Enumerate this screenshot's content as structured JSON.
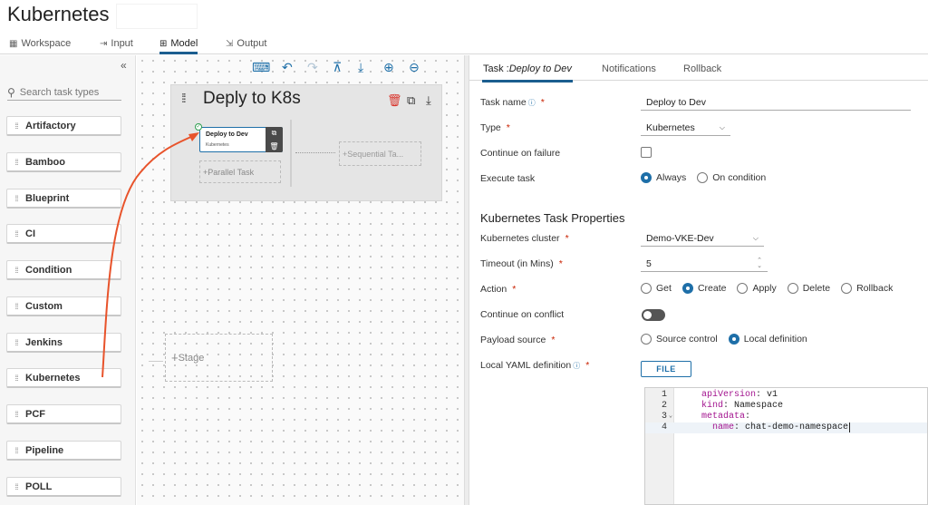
{
  "app": {
    "title": "Kubernetes"
  },
  "main_tabs": [
    {
      "label": "Workspace",
      "icon": "workspace-icon"
    },
    {
      "label": "Input",
      "icon": "input-icon"
    },
    {
      "label": "Model",
      "icon": "model-icon",
      "active": true
    },
    {
      "label": "Output",
      "icon": "output-icon"
    }
  ],
  "palette": {
    "search_placeholder": "Search task types",
    "items": [
      "Artifactory",
      "Bamboo",
      "Blueprint",
      "CI",
      "Condition",
      "Custom",
      "Jenkins",
      "Kubernetes",
      "PCF",
      "Pipeline",
      "POLL"
    ]
  },
  "canvas": {
    "stage": {
      "title": "Deply to K8s",
      "task": {
        "name": "Deploy to Dev",
        "type": "Kubernetes"
      },
      "parallel_task_label": "Parallel Task",
      "sequential_task_label": "Sequential Ta..."
    },
    "empty_stage_label": "Stage"
  },
  "panel": {
    "tabs": {
      "task_prefix": "Task :",
      "task_name": "Deploy to Dev",
      "notifications": "Notifications",
      "rollback": "Rollback"
    },
    "task_name": {
      "label": "Task name",
      "value": "Deploy to Dev"
    },
    "type": {
      "label": "Type",
      "value": "Kubernetes"
    },
    "continue_on_failure": {
      "label": "Continue on failure",
      "checked": false
    },
    "execute_task": {
      "label": "Execute task",
      "options": [
        "Always",
        "On condition"
      ],
      "selected": "Always"
    },
    "section_title": "Kubernetes Task Properties",
    "cluster": {
      "label": "Kubernetes cluster",
      "value": "Demo-VKE-Dev"
    },
    "timeout": {
      "label": "Timeout (in Mins)",
      "value": "5"
    },
    "action": {
      "label": "Action",
      "options": [
        "Get",
        "Create",
        "Apply",
        "Delete",
        "Rollback"
      ],
      "selected": "Create"
    },
    "continue_on_conflict": {
      "label": "Continue on conflict",
      "on": false
    },
    "payload_source": {
      "label": "Payload source",
      "options": [
        "Source control",
        "Local definition"
      ],
      "selected": "Local definition"
    },
    "local_yaml": {
      "label": "Local YAML definition",
      "file_button": "FILE"
    },
    "yaml_lines": [
      {
        "n": "1",
        "key": "apiVersion",
        "sep": ": ",
        "val": "v1"
      },
      {
        "n": "2",
        "key": "kind",
        "sep": ": ",
        "val": "Namespace"
      },
      {
        "n": "3",
        "key": "metadata",
        "sep": ":",
        "val": ""
      },
      {
        "n": "4",
        "key": "  name",
        "sep": ": ",
        "val": "chat-demo-namespace"
      }
    ]
  },
  "colors": {
    "accent": "#1e6fa8",
    "required": "#c92100",
    "drag_arrow": "#e8532b",
    "delete_icon": "#d9342b"
  }
}
